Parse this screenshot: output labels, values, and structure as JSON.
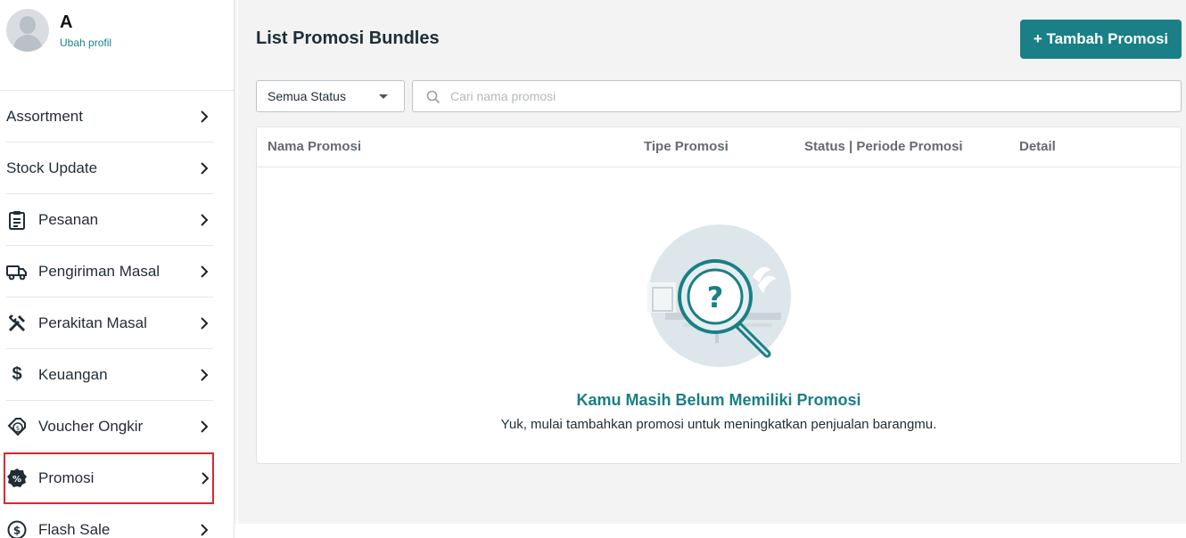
{
  "profile": {
    "name": "A",
    "edit_link": "Ubah profil"
  },
  "sidebar": {
    "items": [
      {
        "label": "Assortment",
        "icon": "none"
      },
      {
        "label": "Stock Update",
        "icon": "none"
      },
      {
        "label": "Pesanan",
        "icon": "clipboard-icon"
      },
      {
        "label": "Pengiriman Masal",
        "icon": "truck-icon"
      },
      {
        "label": "Perakitan Masal",
        "icon": "tools-icon"
      },
      {
        "label": "Keuangan",
        "icon": "dollar-icon"
      },
      {
        "label": "Voucher Ongkir",
        "icon": "voucher-icon"
      },
      {
        "label": "Promosi",
        "icon": "percent-badge-icon",
        "highlighted": true
      },
      {
        "label": "Flash Sale",
        "icon": "dollar-circle-icon"
      }
    ]
  },
  "main": {
    "title": "List Promosi Bundles",
    "add_button": "+ Tambah Promosi",
    "status_filter": "Semua Status",
    "search_placeholder": "Cari nama promosi",
    "table": {
      "columns": [
        "Nama Promosi",
        "Tipe Promosi",
        "Status | Periode Promosi",
        "Detail"
      ],
      "rows": []
    },
    "empty_state": {
      "title": "Kamu Masih Belum Memiliki Promosi",
      "description": "Yuk, mulai tambahkan promosi untuk meningkatkan penjualan barangmu."
    }
  },
  "colors": {
    "accent": "#1a7f86",
    "highlight_outline": "#e0262f",
    "background": "#f3f3f3"
  }
}
